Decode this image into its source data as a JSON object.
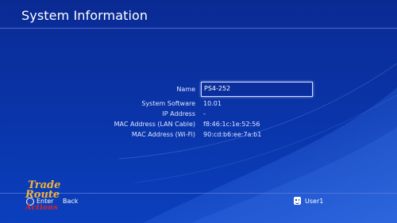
{
  "header": {
    "title": "System Information"
  },
  "info": {
    "name_label": "Name",
    "name_value": "PS4-252",
    "rows": [
      {
        "label": "System Software",
        "value": "10.01"
      },
      {
        "label": "IP Address",
        "value": "-"
      },
      {
        "label": "MAC Address (LAN Cable)",
        "value": "f8:46:1c:1e:52:56"
      },
      {
        "label": "MAC Address (Wi-Fi)",
        "value": "90:cd:b6:ee:7a:b1"
      }
    ]
  },
  "footer": {
    "enter_label": "Enter",
    "back_label": "Back",
    "user_label": "User1"
  },
  "watermark": {
    "line1": "Trade",
    "line2": "Route",
    "line3": "Actions"
  },
  "colors": {
    "background": "#0a33a6",
    "text": "#dfe6ff",
    "field_border": "#cfd9ff"
  }
}
